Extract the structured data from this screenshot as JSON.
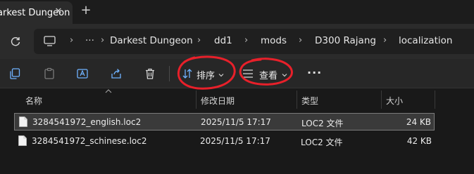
{
  "tab": {
    "title": "Darkest Dungeon",
    "close_glyph": "✕",
    "new_tab_glyph": "+"
  },
  "address": {
    "separator": "›",
    "overflow": "···",
    "crumbs": [
      "Darkest Dungeon",
      "dd1",
      "mods",
      "D300 Rajang",
      "localization"
    ]
  },
  "toolbar": {
    "sort_label": "排序",
    "view_label": "查看",
    "more_glyph": "···"
  },
  "columns": {
    "name": "名称",
    "modified": "修改日期",
    "type": "类型",
    "size": "大小"
  },
  "files": [
    {
      "name": "3284541972_english.loc2",
      "modified": "2025/11/5 17:17",
      "type": "LOC2 文件",
      "size": "24 KB",
      "selected": true
    },
    {
      "name": "3284541972_schinese.loc2",
      "modified": "2025/11/5 17:17",
      "type": "LOC2 文件",
      "size": "42 KB",
      "selected": false
    }
  ],
  "colors": {
    "annotation": "#e8202a",
    "accent": "#4aa3ff"
  }
}
